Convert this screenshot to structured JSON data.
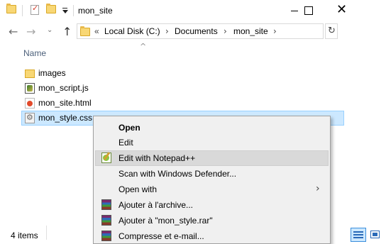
{
  "window": {
    "title": "mon_site",
    "minimize_glyph": "—",
    "maximize_glyph": "☐",
    "close_glyph": "✕"
  },
  "quick_access": {
    "icons": [
      "folder-icon",
      "properties-icon",
      "new-folder-icon",
      "customize-dropdown-icon"
    ]
  },
  "navigation": {
    "back_glyph": "←",
    "forward_glyph": "→",
    "recent_glyph": "⌄",
    "up_glyph": "↑",
    "overflow_glyph": "«",
    "breadcrumbs": [
      "Local Disk (C:)",
      "Documents",
      "mon_site"
    ],
    "crumb_separator": "›",
    "dropdown_glyph": "⌄",
    "refresh_glyph": "↻"
  },
  "file_list": {
    "column_name": "Name",
    "sort_glyph": "^",
    "items": [
      {
        "name": "images",
        "icon": "folder-icon",
        "selected": false
      },
      {
        "name": "mon_script.js",
        "icon": "javascript-file-icon",
        "selected": false
      },
      {
        "name": "mon_site.html",
        "icon": "html-file-icon",
        "selected": false
      },
      {
        "name": "mon_style.css",
        "icon": "css-file-icon",
        "selected": true
      }
    ]
  },
  "status_bar": {
    "item_count": "4 items",
    "view_buttons": [
      "details-view",
      "large-icons-view"
    ]
  },
  "context_menu": {
    "items": [
      {
        "label": "Open",
        "bold": true,
        "icon": null
      },
      {
        "label": "Edit",
        "bold": false,
        "icon": null
      },
      {
        "label": "Edit with Notepad++",
        "bold": false,
        "icon": "notepad-plus-plus-icon",
        "highlighted": true
      },
      {
        "label": "Scan with Windows Defender...",
        "bold": false,
        "icon": null
      },
      {
        "label": "Open with",
        "bold": false,
        "icon": null,
        "submenu": true
      },
      {
        "label": "Ajouter à l'archive...",
        "bold": false,
        "icon": "winrar-icon"
      },
      {
        "label": "Ajouter à \"mon_style.rar\"",
        "bold": false,
        "icon": "winrar-icon"
      },
      {
        "label": "Compresse et e-mail...",
        "bold": false,
        "icon": "winrar-icon"
      }
    ],
    "submenu_glyph": "›"
  },
  "colors": {
    "selection_bg": "#cce8ff",
    "selection_border": "#99d1ff",
    "menu_bg": "#f0f0f0",
    "menu_highlight": "#d9d9d9",
    "header_text": "#4c607a"
  }
}
